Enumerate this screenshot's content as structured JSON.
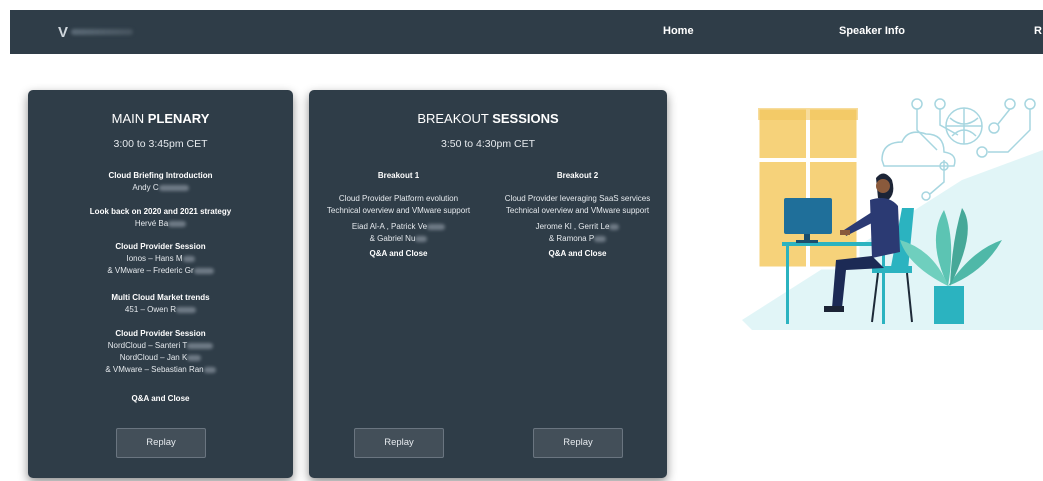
{
  "nav": {
    "logo_letter": "V",
    "items": [
      "Home",
      "Speaker Info",
      "R"
    ]
  },
  "plenary": {
    "title_light": "MAIN ",
    "title_bold": "PLENARY",
    "time": "3:00 to 3:45pm CET",
    "sessions": [
      {
        "title": "Cloud Briefing Introduction",
        "lines": [
          "Andy C"
        ]
      },
      {
        "title": "Look back on 2020 and 2021 strategy",
        "lines": [
          "Hervé Ba"
        ]
      },
      {
        "title": "Cloud Provider Session",
        "lines": [
          "Ionos – Hans M",
          "& VMware – Frederic Gr"
        ]
      },
      {
        "title": "Multi Cloud Market trends",
        "lines": [
          "451 – Owen R"
        ]
      },
      {
        "title": "Cloud Provider Session",
        "lines": [
          "NordCloud – Santeri T",
          "NordCloud – Jan K",
          "& VMware – Sebastian Ran"
        ]
      },
      {
        "title": "Q&A and Close",
        "lines": []
      }
    ],
    "replay": "Replay"
  },
  "breakout": {
    "title_light": "BREAKOUT ",
    "title_bold": "SESSIONS",
    "time": "3:50 to 4:30pm CET",
    "columns": [
      {
        "heading": "Breakout 1",
        "lines": [
          "Cloud Provider Platform evolution",
          "Technical overview and VMware support"
        ],
        "speakers": [
          "Eiad Al-A , Patrick Ve",
          "& Gabriel Nu"
        ],
        "close": "Q&A and Close",
        "replay": "Replay"
      },
      {
        "heading": "Breakout 2",
        "lines": [
          "Cloud Provider leveraging SaaS services",
          "Technical overview and VMware support"
        ],
        "speakers": [
          "Jerome Kl , Gerrit Le",
          "& Ramona P"
        ],
        "close": "Q&A and Close",
        "replay": "Replay"
      }
    ]
  },
  "colors": {
    "navbar": "#2f3d48",
    "card": "#2f3d48",
    "accent_teal": "#2bb3c0",
    "accent_yellow": "#f6d27a"
  }
}
